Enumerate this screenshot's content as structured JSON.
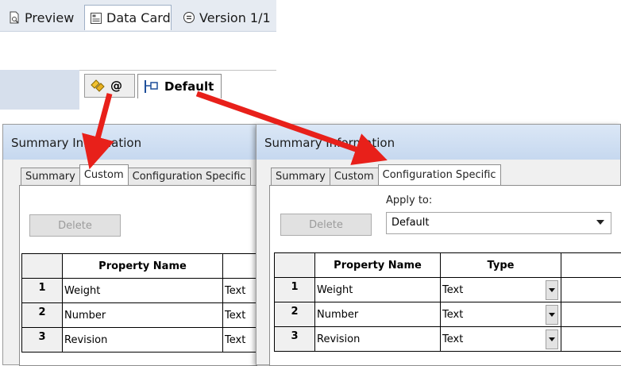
{
  "top_tabs": [
    {
      "label": "Preview",
      "icon": "document-search-icon"
    },
    {
      "label": "Data Card",
      "icon": "data-card-icon"
    },
    {
      "label": "Version 1/1",
      "icon": "version-icon"
    }
  ],
  "config_tabs": {
    "at_label": "@",
    "default_label": "Default"
  },
  "left_dialog": {
    "title": "Summary Information",
    "tabs": [
      "Summary",
      "Custom",
      "Configuration Specific"
    ],
    "selected_tab": "Custom",
    "delete_label": "Delete",
    "columns": [
      "Property Name"
    ],
    "rows": [
      {
        "num": "1",
        "name": "Weight",
        "type": "Text"
      },
      {
        "num": "2",
        "name": "Number",
        "type": "Text"
      },
      {
        "num": "3",
        "name": "Revision",
        "type": "Text"
      }
    ]
  },
  "right_dialog": {
    "title": "Summary Information",
    "tabs": [
      "Summary",
      "Custom",
      "Configuration Specific"
    ],
    "selected_tab": "Configuration Specific",
    "delete_label": "Delete",
    "apply_to_label": "Apply to:",
    "apply_to_value": "Default",
    "columns": [
      "Property Name",
      "Type"
    ],
    "rows": [
      {
        "num": "1",
        "name": "Weight",
        "type": "Text"
      },
      {
        "num": "2",
        "name": "Number",
        "type": "Text"
      },
      {
        "num": "3",
        "name": "Revision",
        "type": "Text"
      }
    ]
  },
  "colors": {
    "arrow": "#e8201a",
    "titlebar": "#c6d8ef"
  }
}
